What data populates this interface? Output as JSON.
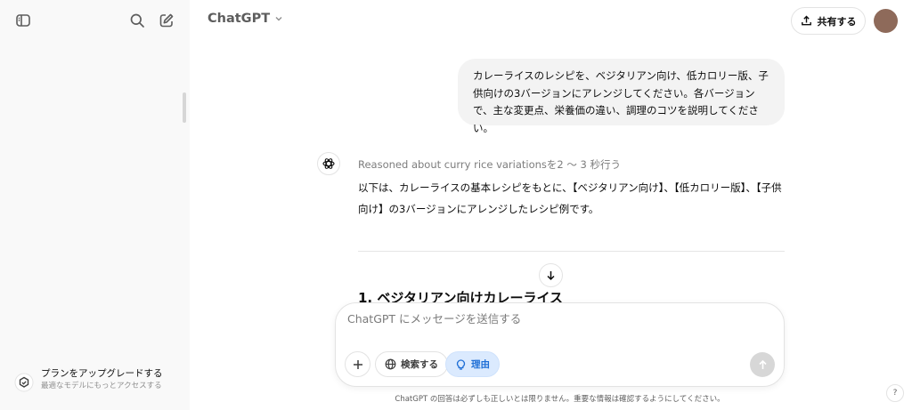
{
  "header": {
    "model_name": "ChatGPT",
    "share_label": "共有する"
  },
  "sidebar": {
    "upgrade_title": "プランをアップグレードする",
    "upgrade_subtitle": "最適なモデルにもっとアクセスする"
  },
  "conversation": {
    "user_message": "カレーライスのレシピを、ベジタリアン向け、低カロリー版、子供向けの3バージョンにアレンジしてください。各バージョンで、主な変更点、栄養価の違い、調理のコツを説明してください。",
    "reasoning_label": "Reasoned about curry rice variationsを2 〜 3 秒行う",
    "assistant_reply": "以下は、カレーライスの基本レシピをもとに、【ベジタリアン向け】、【低カロリー版】、【子供向け】の3バージョンにアレンジしたレシピ例です。",
    "section_heading": "1. ベジタリアン向けカレーライス"
  },
  "composer": {
    "placeholder": "ChatGPT にメッセージを送信する",
    "search_label": "検索する",
    "reason_label": "理由"
  },
  "footer": {
    "disclaimer": "ChatGPT の回答は必ずしも正しいとは限りません。重要な情報は確認するようにしてください。",
    "help_label": "?"
  },
  "colors": {
    "sidebar_bg": "#f9f9f9",
    "user_bubble_bg": "#f3f3f3",
    "reason_pill_bg": "#dbeafe",
    "reason_pill_text": "#1f6fd6",
    "avatar": "#8e6a5a"
  },
  "icons": {
    "sidebar_toggle": "sidebar-toggle-icon",
    "search": "search-icon",
    "new_chat": "new-chat-icon",
    "share": "share-upload-icon",
    "openai": "openai-logo-icon",
    "scroll_down": "arrow-down-icon",
    "attach": "plus-icon",
    "globe": "globe-icon",
    "bulb": "lightbulb-icon",
    "send": "arrow-up-icon"
  }
}
